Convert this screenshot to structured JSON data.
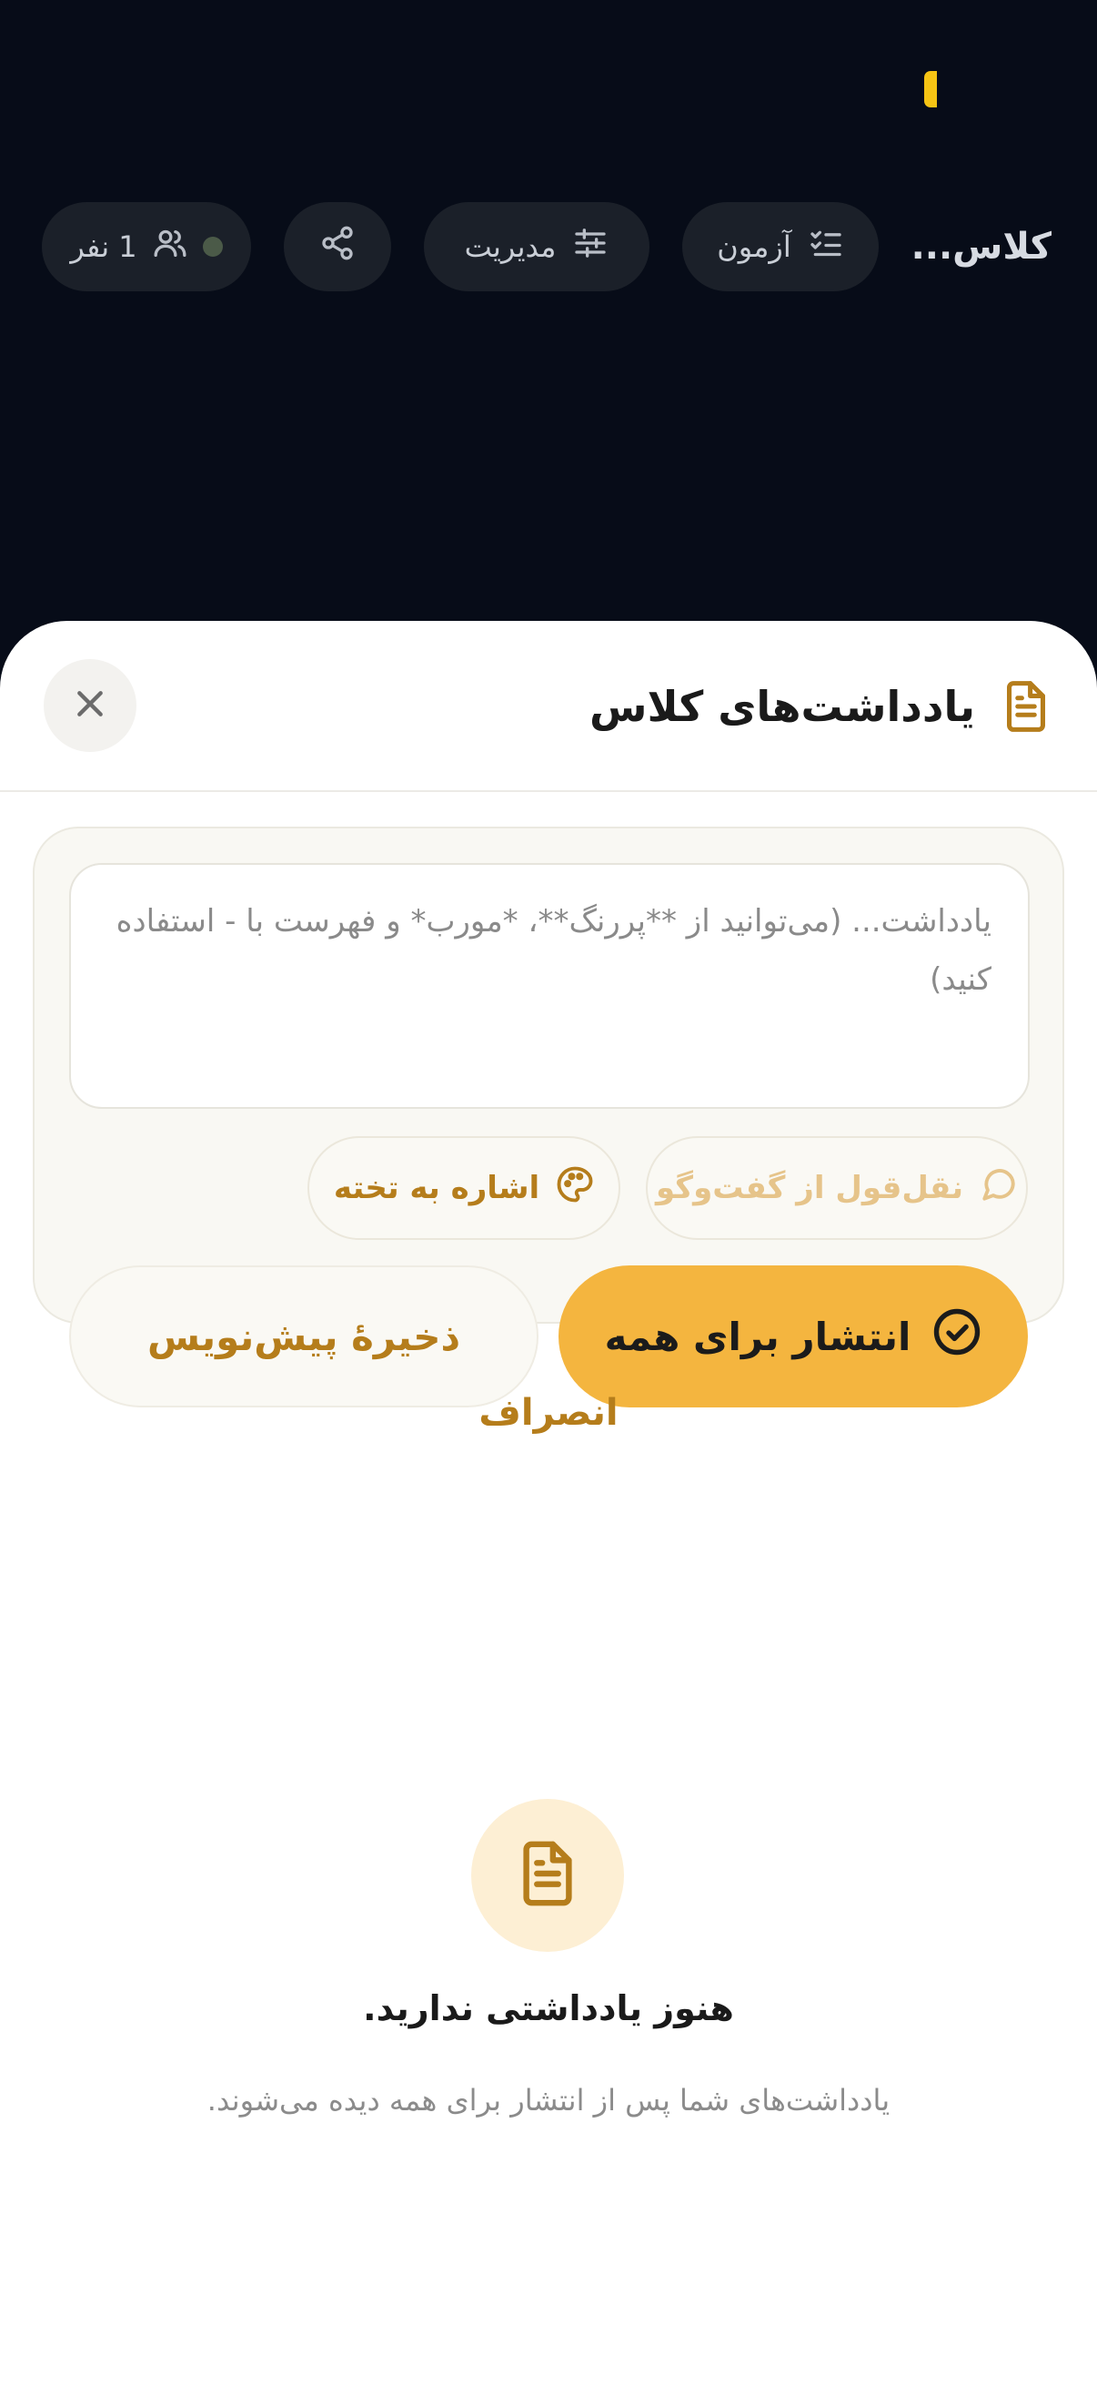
{
  "header": {
    "class_title": "کلاس...",
    "exam_label": "آزمون",
    "manage_label": "مدیریت",
    "members_label": "1 نفر"
  },
  "sheet": {
    "title": "یادداشت‌های کلاس",
    "note_placeholder": "یادداشت... (می‌توانید از **پررنگ**، *مورب* و فهرست با - استفاده کنید)",
    "quote_chip_label": "نقل‌قول از گفت‌وگو",
    "board_chip_label": "اشاره به تخته",
    "publish_label": "انتشار برای همه",
    "draft_label": "ذخیرهٔ پیش‌نویس",
    "cancel_label": "انصراف"
  },
  "empty_state": {
    "title": "هنوز یادداشتی ندارید.",
    "description": "یادداشت‌های شما پس از انتشار برای همه دیده می‌شوند."
  },
  "colors": {
    "accent": "#f4b53f",
    "accent_text": "#b57d1b",
    "dark_bg": "#070c18",
    "status_yellow": "#f6c414"
  },
  "icons": {
    "exam": "checklist-icon",
    "manage": "sliders-icon",
    "share": "share-icon",
    "members": "users-icon",
    "sheet_title": "document-icon",
    "close": "close-icon",
    "quote": "chat-bubble-icon",
    "board": "palette-icon",
    "publish": "check-circle-icon",
    "empty": "document-icon"
  }
}
